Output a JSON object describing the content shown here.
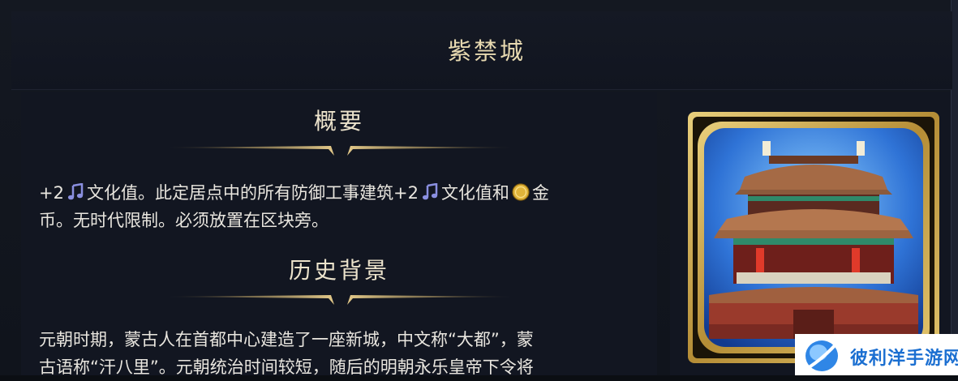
{
  "window": {
    "title": "紫禁城"
  },
  "overview": {
    "heading": "概要",
    "line1": {
      "part1": "+2",
      "part2": "文化值。此定居点中的所有防御工事建筑+2",
      "part3": "文化值和",
      "part4": "金"
    },
    "line2": "币。无时代限制。必须放置在区块旁。"
  },
  "history": {
    "heading": "历史背景",
    "line1": "元朝时期，蒙古人在首都中心建造了一座新城，中文称“大都”，蒙",
    "line2": "古语称“汗八里”。元朝统治时间较短，随后的明朝永乐皇帝下令将"
  },
  "icons": {
    "culture": "music-note-icon",
    "gold": "gold-coin-icon"
  },
  "watermark": {
    "text": "彼利洋手游网"
  },
  "colors": {
    "background": "#10141c",
    "title": "#e7d9b0",
    "heading": "#ece3cc",
    "body_text": "#e9e6df",
    "culture_icon": "#8a8fe0",
    "gold_icon": "#e0b43a",
    "frame_gold": "#c8a64d",
    "watermark_text": "#1b6fd1"
  }
}
